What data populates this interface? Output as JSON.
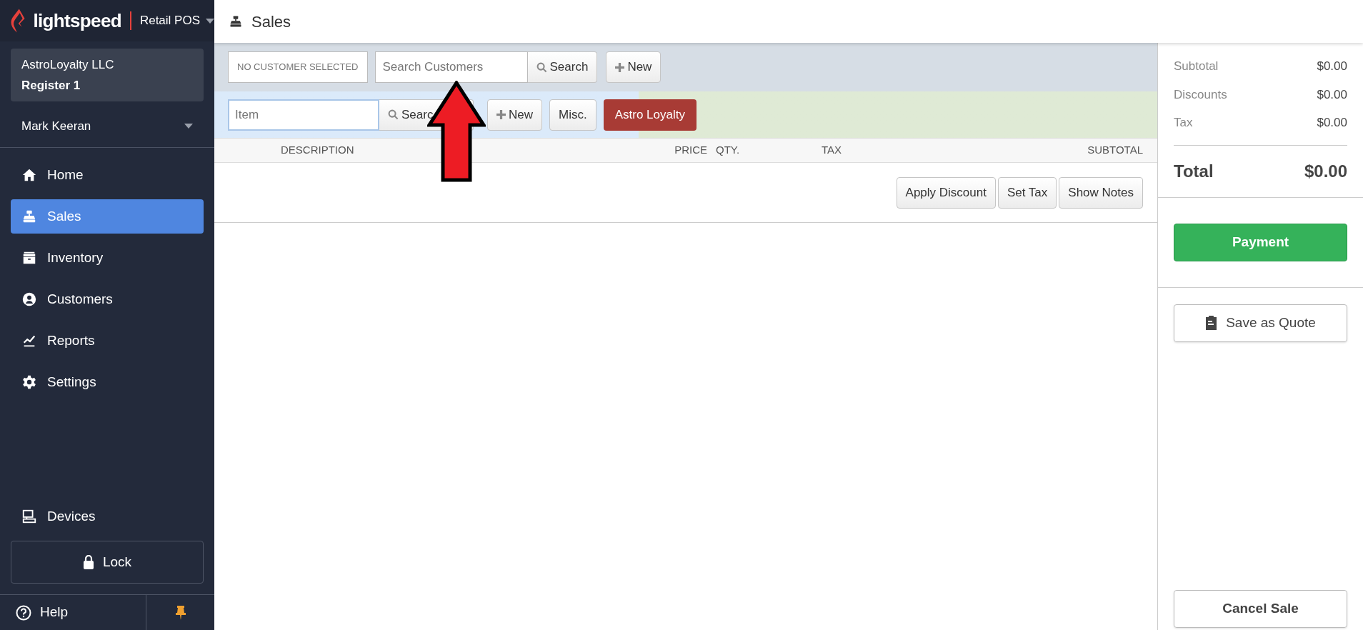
{
  "brand": {
    "logo": "lightspeed",
    "product": "Retail POS"
  },
  "account": {
    "company": "AstroLoyalty LLC",
    "register": "Register 1"
  },
  "user": {
    "name": "Mark Keeran"
  },
  "nav": [
    {
      "label": "Home",
      "kind": "home",
      "selected": false
    },
    {
      "label": "Sales",
      "kind": "sales",
      "selected": true
    },
    {
      "label": "Inventory",
      "kind": "inventory",
      "selected": false
    },
    {
      "label": "Customers",
      "kind": "customers",
      "selected": false
    },
    {
      "label": "Reports",
      "kind": "reports",
      "selected": false
    },
    {
      "label": "Settings",
      "kind": "settings",
      "selected": false
    }
  ],
  "devices": {
    "label": "Devices"
  },
  "lock": {
    "label": "Lock"
  },
  "help": {
    "label": "Help"
  },
  "page": {
    "title": "Sales"
  },
  "customer_bar": {
    "status": "NO CUSTOMER SELECTED",
    "placeholder": "Search Customers",
    "search": "Search",
    "new": "New"
  },
  "item_bar": {
    "placeholder": "Item",
    "search": "Searc",
    "new": "New",
    "misc": "Misc.",
    "loyalty": "Astro Loyalty"
  },
  "table": {
    "columns": [
      "DESCRIPTION",
      "PRICE",
      "QTY.",
      "TAX",
      "SUBTOTAL"
    ]
  },
  "actions": [
    "Apply Discount",
    "Set Tax",
    "Show Notes"
  ],
  "summary": {
    "rows": [
      {
        "label": "Subtotal",
        "value": "$0.00"
      },
      {
        "label": "Discounts",
        "value": "$0.00"
      },
      {
        "label": "Tax",
        "value": "$0.00"
      }
    ],
    "total_label": "Total",
    "total_value": "$0.00"
  },
  "payment": "Payment",
  "save_quote": "Save as Quote",
  "cancel": "Cancel Sale",
  "annotation": {
    "kind": "arrow"
  }
}
